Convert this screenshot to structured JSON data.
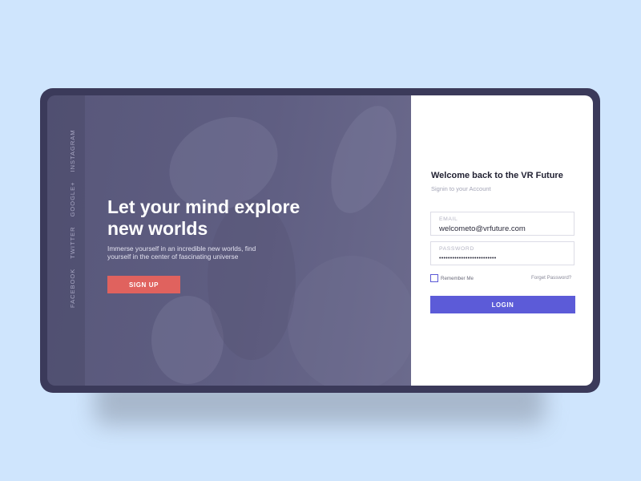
{
  "hero": {
    "headline": "Let your mind explore new worlds",
    "subtext": "Immerse yourself in an incredible new worlds, find yourself in the center of fascinating universe",
    "signup_label": "SIGN UP"
  },
  "social": {
    "facebook": "FACEBOOK",
    "twitter": "TWITTER",
    "google": "GOOGLE+",
    "instagram": "INSTAGRAM"
  },
  "form": {
    "title": "Welcome back to the VR Future",
    "subtitle": "Signin to your Account",
    "email_label": "EMAIL",
    "email_value": "welcometo@vrfuture.com",
    "password_label": "PASSWORD",
    "password_value": "••••••••••••••••••••••••••",
    "remember_label": "Remember Me",
    "forgot_label": "Forget Password?",
    "login_label": "LOGIN"
  },
  "colors": {
    "background": "#cfe5fd",
    "device_frame": "#3b3a5a",
    "hero_overlay": "#5f5e82",
    "signup_button": "#e0625e",
    "login_button": "#5c5bd8"
  }
}
